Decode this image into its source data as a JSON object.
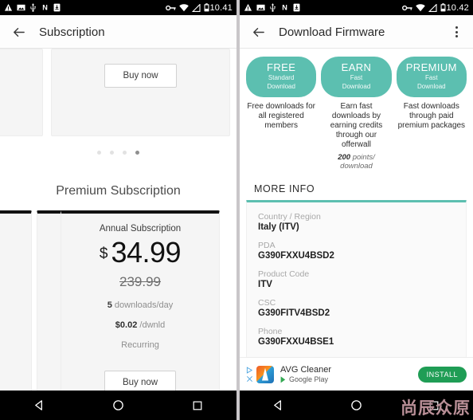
{
  "left_screen": {
    "status_bar": {
      "time": "10.41",
      "icons_left": [
        "warning-triangle-icon",
        "image-icon",
        "usb-icon",
        "nfc-icon",
        "download-icon"
      ],
      "icons_right": [
        "vpn-key-icon",
        "wifi-icon",
        "signal-icon",
        "battery-icon"
      ]
    },
    "app_bar": {
      "back": "back-arrow-icon",
      "title": "Subscription"
    },
    "top_card": {
      "buy_label": "Buy now"
    },
    "top_dots": {
      "count": 4,
      "active_index": 3
    },
    "section_title": "Premium Subscription",
    "premium_card": {
      "plan_name": "Annual Subscription",
      "currency": "$",
      "price": "34.99",
      "old_price": "239.99",
      "downloads_value": "5",
      "downloads_label": "downloads/day",
      "per_download_price": "$0.02",
      "per_download_label": "/dwnld",
      "recurring": "Recurring",
      "buy_label": "Buy now"
    },
    "bottom_dots": {
      "count": 4,
      "active_index": 3
    },
    "nav_bar": [
      "back-triangle-icon",
      "home-circle-icon",
      "recents-square-icon"
    ]
  },
  "right_screen": {
    "status_bar": {
      "time": "10.42",
      "icons_left": [
        "warning-triangle-icon",
        "image-icon",
        "usb-icon",
        "nfc-icon",
        "download-icon"
      ],
      "icons_right": [
        "vpn-key-icon",
        "wifi-icon",
        "signal-icon",
        "battery-icon"
      ]
    },
    "app_bar": {
      "back": "back-arrow-icon",
      "title": "Download Firmware",
      "menu": "overflow-menu-icon"
    },
    "badges": [
      {
        "title": "FREE",
        "subtitle_line1": "Standard",
        "subtitle_line2": "Download",
        "description": "Free downloads for all registered members",
        "points": "",
        "points_label": ""
      },
      {
        "title": "EARN",
        "subtitle_line1": "Fast",
        "subtitle_line2": "Download",
        "description": "Earn fast downloads by earning credits through our offerwall",
        "points": "200",
        "points_label": "points/ download"
      },
      {
        "title": "PREMIUM",
        "subtitle_line1": "Fast",
        "subtitle_line2": "Download",
        "description": "Fast downloads through paid premium packages",
        "points": "",
        "points_label": ""
      }
    ],
    "more_info_heading": "MORE INFO",
    "info_rows": [
      {
        "label": "Country / Region",
        "value": "Italy (ITV)"
      },
      {
        "label": "PDA",
        "value": "G390FXXU4BSD2"
      },
      {
        "label": "Product Code",
        "value": "ITV"
      },
      {
        "label": "CSC",
        "value": "G390FITV4BSD2"
      },
      {
        "label": "Phone",
        "value": "G390FXXU4BSE1"
      }
    ],
    "ad": {
      "title": "AVG Cleaner",
      "store": "Google Play",
      "install_label": "INSTALL",
      "adchoices": "adchoices-icon"
    },
    "nav_bar": [
      "back-triangle-icon",
      "home-circle-icon",
      "recents-square-icon"
    ]
  },
  "watermark": "尚辰众原",
  "colors": {
    "teal": "#5cbfb0",
    "install_green": "#1f9d55",
    "card_bg": "#f5f5f5",
    "accent_black": "#111111"
  }
}
